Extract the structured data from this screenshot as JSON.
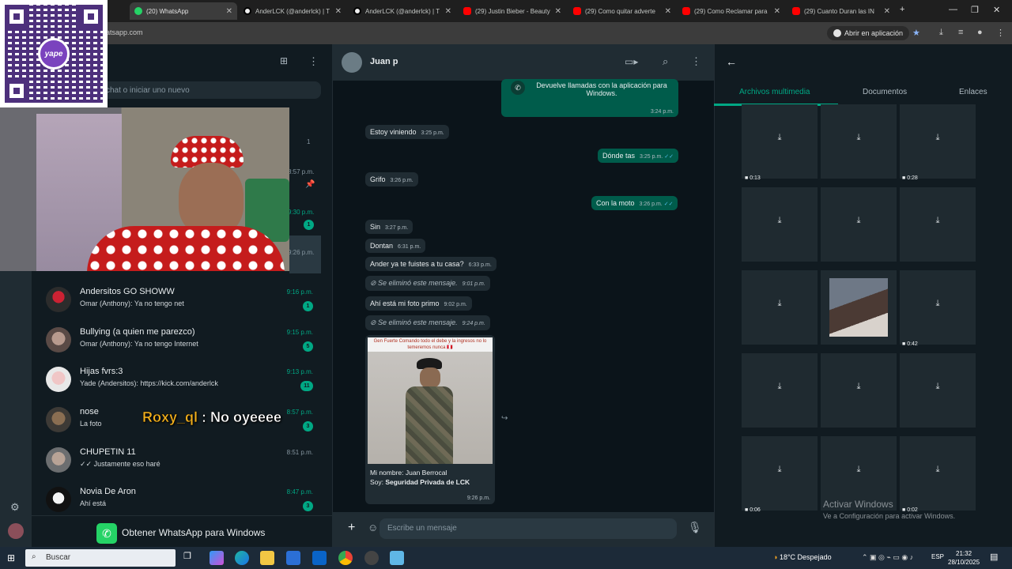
{
  "browser": {
    "tabs": [
      {
        "label": "(20) WhatsApp",
        "color": "#25d366"
      },
      {
        "label": "AnderLCK (@anderlck) | T",
        "color": "#000000"
      },
      {
        "label": "AnderLCK (@anderlck) | T",
        "color": "#000000"
      },
      {
        "label": "(29) Justin Bieber - Beauty",
        "color": "#ff0000"
      },
      {
        "label": "(29) Como quitar adverte",
        "color": "#ff0000"
      },
      {
        "label": "(29) Como Reclamar para",
        "color": "#ff0000"
      },
      {
        "label": "(29) Cuanto Duran las IN",
        "color": "#ff0000"
      }
    ],
    "url": "atsapp.com",
    "open_app_label": "Abrir en aplicación"
  },
  "overlay": {
    "qr_brand": "yape",
    "stream_user": "Roxy_ql",
    "stream_message": " : No oyeeee"
  },
  "sidebar": {
    "search_placeholder": "chat o iniciar uno nuevo",
    "partial_times": [
      "1",
      "8:57 p.m.",
      "9:30 p.m.",
      "9:26 p.m."
    ],
    "partial_badge": "1",
    "chats": [
      {
        "name": "Andersitos GO SHOWW",
        "preview": "Omar (Anthony): Ya no tengo net",
        "time": "9:16 p.m.",
        "badge": "1"
      },
      {
        "name": "Bullying (a quien me parezco)",
        "preview": "Omar (Anthony): Ya no tengo Internet",
        "time": "9:15 p.m.",
        "badge": "5"
      },
      {
        "name": "Hijas fvrs:3",
        "preview": "Yade (Andersitos): https://kick.com/anderlck",
        "time": "9:13 p.m.",
        "badge": "11"
      },
      {
        "name": "nose",
        "preview": "La foto",
        "time": "8:57 p.m.",
        "badge": "3"
      },
      {
        "name": "CHUPETIN 11",
        "preview": "✓✓ Justamente eso haré",
        "time": "8:51 p.m.",
        "badge": ""
      },
      {
        "name": "Novia De Aron",
        "preview": "Ahí está",
        "time": "8:47 p.m.",
        "badge": "3"
      }
    ],
    "get_app_label": "Obtener WhatsApp para Windows"
  },
  "conversation": {
    "contact_name": "Juan p",
    "call_banner": "Devuelve llamadas con la aplicación para Windows.",
    "call_banner_time": "3:24 p.m.",
    "messages": [
      {
        "text": "Estoy viniendo",
        "time": "3:25 p.m."
      },
      {
        "text": "Dónde tas",
        "time": "3:25 p.m."
      },
      {
        "text": "Grifo",
        "time": "3:26 p.m."
      },
      {
        "text": "Con la moto",
        "time": "3:26 p.m."
      },
      {
        "text": "Sin",
        "time": "3:27 p.m."
      },
      {
        "text": "Dontan",
        "time": "6:31 p.m."
      },
      {
        "text": "Ander ya te fuistes a tu casa?",
        "time": "6:33 p.m."
      },
      {
        "text": "Se eliminó este mensaje.",
        "time": "9:01 p.m."
      },
      {
        "text": "Ahí está mi foto primo",
        "time": "9:02 p.m."
      },
      {
        "text": "Se eliminó este mensaje.",
        "time": "9:24 p.m."
      }
    ],
    "image_header": "Gen Fuerte Comando todo el debe y la ingresos no lo temeremos nunca 🇵🇪",
    "image_caption_line1": "Mi nombre: Juan Berrocal",
    "image_caption_prefix": "Soy: ",
    "image_caption_bold": "Seguridad Privada de LCK",
    "image_time": "9:26 p.m.",
    "input_placeholder": "Escribe un mensaje"
  },
  "media_panel": {
    "tabs": [
      "Archivos multimedia",
      "Documentos",
      "Enlaces"
    ],
    "durations": [
      "0:13",
      "0:28",
      "0:42",
      "0:06",
      "0:02"
    ]
  },
  "watermark": {
    "line1": "Activar Windows",
    "line2": "Ve a Configuración para activar Windows."
  },
  "taskbar": {
    "search_label": "Buscar",
    "weather": "18°C Despejado",
    "lang": "ESP",
    "time": "21:32",
    "date": "28/10/2025"
  },
  "colors": {
    "accent": "#00a884",
    "outgoing_bubble": "#005c4b",
    "incoming_bubble": "#202c33",
    "panel_bg": "#111b21"
  }
}
